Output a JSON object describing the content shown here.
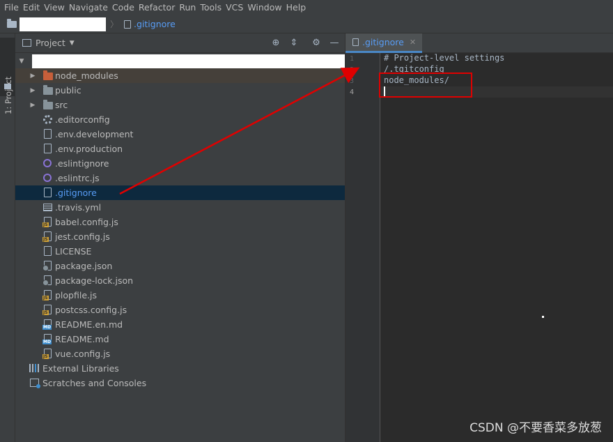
{
  "menu": [
    "File",
    "Edit",
    "View",
    "Navigate",
    "Code",
    "Refactor",
    "Run",
    "Tools",
    "VCS",
    "Window",
    "Help"
  ],
  "navbar": {
    "file": ".gitignore"
  },
  "toolstrip": {
    "label": "1: Project"
  },
  "project_panel": {
    "title": "Project"
  },
  "tree": [
    {
      "label": "node_modules",
      "icon": "folder-orange",
      "expandable": true,
      "style": "excluded"
    },
    {
      "label": "public",
      "icon": "folder",
      "expandable": true
    },
    {
      "label": "src",
      "icon": "folder",
      "expandable": true
    },
    {
      "label": ".editorconfig",
      "icon": "gear-icon"
    },
    {
      "label": ".env.development",
      "icon": "file-icon"
    },
    {
      "label": ".env.production",
      "icon": "file-icon"
    },
    {
      "label": ".eslintignore",
      "icon": "eslint-icon"
    },
    {
      "label": ".eslintrc.js",
      "icon": "eslint-icon"
    },
    {
      "label": ".gitignore",
      "icon": "file-icon",
      "selected": true
    },
    {
      "label": ".travis.yml",
      "icon": "yaml-icon"
    },
    {
      "label": "babel.config.js",
      "icon": "js-file-icon"
    },
    {
      "label": "jest.config.js",
      "icon": "js-file-icon"
    },
    {
      "label": "LICENSE",
      "icon": "file-icon"
    },
    {
      "label": "package.json",
      "icon": "json-file-icon"
    },
    {
      "label": "package-lock.json",
      "icon": "json-file-icon"
    },
    {
      "label": "plopfile.js",
      "icon": "js-file-icon"
    },
    {
      "label": "postcss.config.js",
      "icon": "js-file-icon"
    },
    {
      "label": "README.en.md",
      "icon": "md-file-icon"
    },
    {
      "label": "README.md",
      "icon": "md-file-icon"
    },
    {
      "label": "vue.config.js",
      "icon": "js-file-icon"
    }
  ],
  "external_libraries": "External Libraries",
  "scratches": "Scratches and Consoles",
  "editor": {
    "tab": ".gitignore",
    "lines": [
      {
        "no": "1",
        "text": "# Project-level settings"
      },
      {
        "no": "2",
        "text": "/.tgitconfig"
      },
      {
        "no": "3",
        "text": "node_modules/"
      },
      {
        "no": "4",
        "text": ""
      }
    ]
  },
  "colors": {
    "accent": "#589df6",
    "annotation": "#e00000",
    "selection": "#0d293e"
  },
  "watermark": "CSDN @不要香菜多放葱"
}
